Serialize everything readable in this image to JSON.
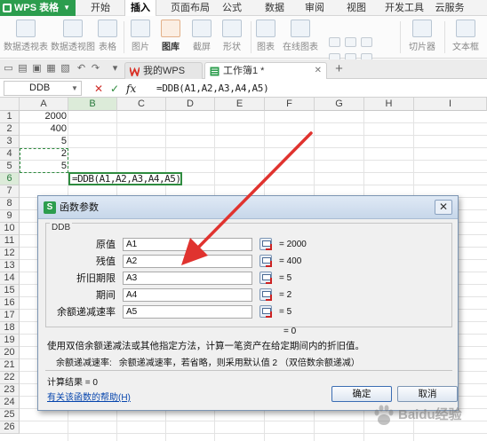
{
  "app": {
    "name": "WPS 表格"
  },
  "menu": {
    "tabs": [
      "开始",
      "插入",
      "页面布局",
      "公式",
      "数据",
      "审阅",
      "视图",
      "开发工具",
      "云服务"
    ],
    "active_index": 1
  },
  "ribbon": {
    "items": [
      "数据透视表",
      "数据透视图",
      "表格",
      "图片",
      "图库",
      "截屏",
      "形状",
      "图表",
      "在线图表",
      "切片器",
      "文本框"
    ]
  },
  "doc_tabs": [
    {
      "label": "我的WPS",
      "active": false
    },
    {
      "label": "工作簿1 *",
      "active": true
    }
  ],
  "formula_bar": {
    "name_box": "DDB",
    "formula": "=DDB(A1,A2,A3,A4,A5)",
    "fx": "fx"
  },
  "sheet": {
    "columns": [
      "A",
      "B",
      "C",
      "D",
      "E",
      "F",
      "G",
      "H",
      "I"
    ],
    "rows": [
      "1",
      "2",
      "3",
      "4",
      "5",
      "6",
      "7",
      "8",
      "9",
      "10",
      "11",
      "12",
      "13",
      "14",
      "15",
      "16",
      "17",
      "18",
      "19",
      "20",
      "21",
      "22",
      "23",
      "24",
      "25",
      "26"
    ],
    "a_values": [
      "2000",
      "400",
      "5",
      "2",
      "5"
    ],
    "b6": "=DDB(A1,A2,A3,A4,A5)"
  },
  "dialog": {
    "title": "函数参数",
    "function_name": "DDB",
    "args": [
      {
        "label": "原值",
        "input": "A1",
        "value": "= 2000"
      },
      {
        "label": "残值",
        "input": "A2",
        "value": "= 400"
      },
      {
        "label": "折旧期限",
        "input": "A3",
        "value": "= 5"
      },
      {
        "label": "期间",
        "input": "A4",
        "value": "= 2"
      },
      {
        "label": "余额递减速率",
        "input": "A5",
        "value": "= 5"
      }
    ],
    "result_line": "= 0",
    "description": "使用双倍余额递减法或其他指定方法，计算一笔资产在给定期间内的折旧值。",
    "arg_desc_name": "余额递减速率:",
    "arg_desc_text": "余额递减速率，若省略，则采用默认值 2 （双倍数余额递减）",
    "calc_result": "计算结果 = 0",
    "help_link": "有关该函数的帮助(H)",
    "ok": "确定",
    "cancel": "取消"
  },
  "watermark": {
    "text": "Baidu经验"
  },
  "colors": {
    "accent": "#2c9d4e",
    "arrow": "#e0332f",
    "dialog_border": "#7d96b4",
    "link": "#0645ad"
  }
}
